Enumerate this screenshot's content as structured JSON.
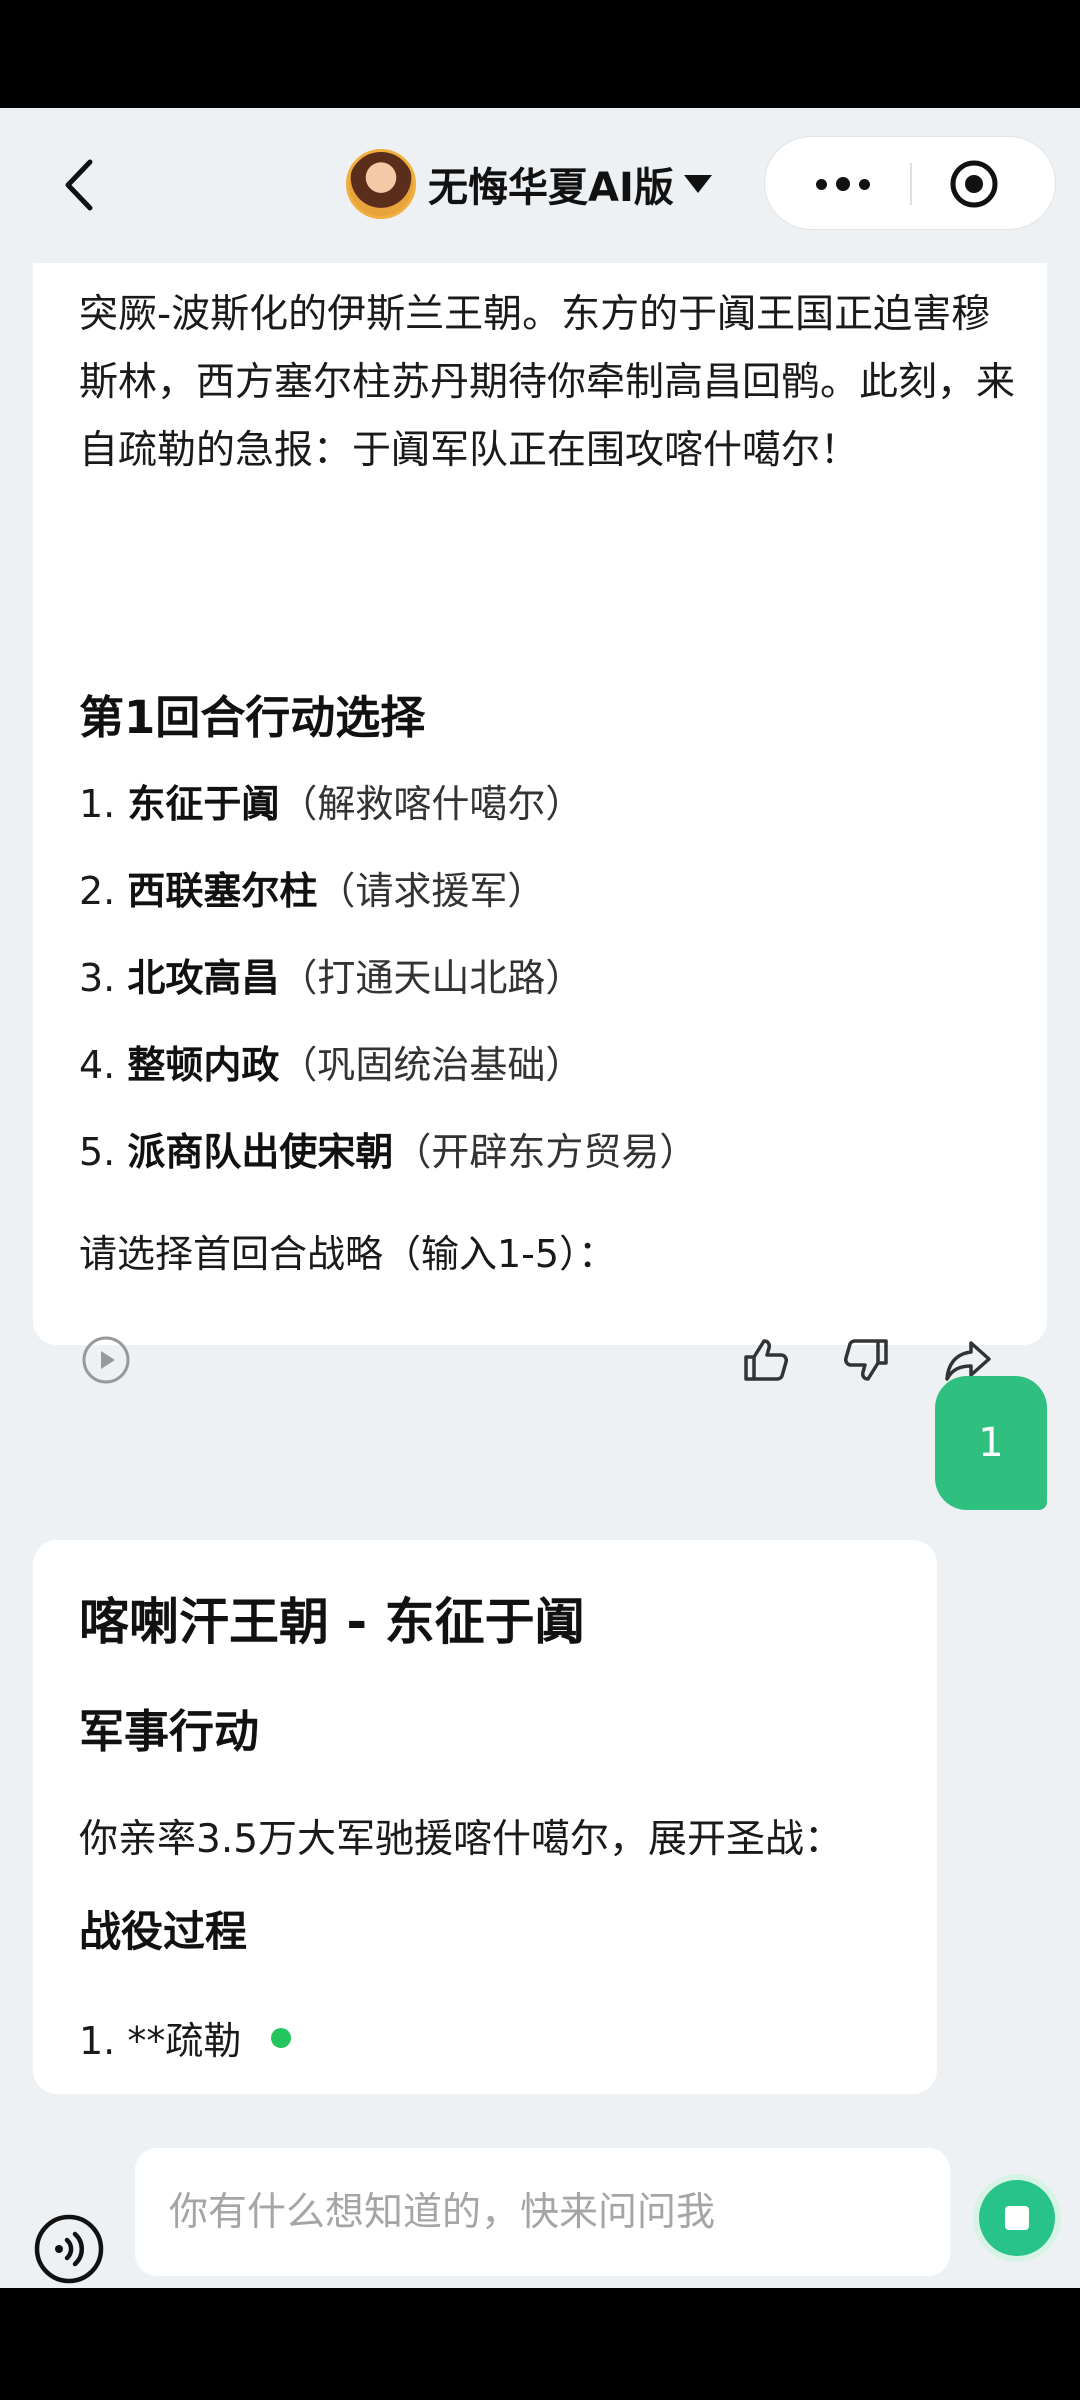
{
  "header": {
    "title": "无悔华夏AI版"
  },
  "message1": {
    "intro": "突厥-波斯化的伊斯兰王朝。东方的于阗王国正迫害穆斯林，西方塞尔柱苏丹期待你牵制高昌回鹘。此刻，来自疏勒的急报：于阗军队正在围攻喀什噶尔！",
    "heading": "第1回合行动选择",
    "options": [
      {
        "num": "1.",
        "label": "东征于阗",
        "note": "（解救喀什噶尔）"
      },
      {
        "num": "2.",
        "label": "西联塞尔柱",
        "note": "（请求援军）"
      },
      {
        "num": "3.",
        "label": "北攻高昌",
        "note": "（打通天山北路）"
      },
      {
        "num": "4.",
        "label": "整顿内政",
        "note": "（巩固统治基础）"
      },
      {
        "num": "5.",
        "label": "派商队出使宋朝",
        "note": "（开辟东方贸易）"
      }
    ],
    "prompt": "请选择首回合战略（输入1-5）："
  },
  "user_message": {
    "text": "1"
  },
  "message2": {
    "title": "喀喇汗王朝 - 东征于阗",
    "subtitle": "军事行动",
    "text": "你亲率3.5万大军驰援喀什噶尔，展开圣战：",
    "subtitle2": "战役过程",
    "item": "1. **疏勒"
  },
  "input": {
    "placeholder": "你有什么想知道的，快来问问我"
  },
  "colors": {
    "accent_green": "#2fc07f",
    "background": "#eef1f4",
    "typing_dot": "#22c55e"
  },
  "icons": [
    "back-arrow-icon",
    "avatar",
    "caret-down-icon",
    "more-icon",
    "record-icon",
    "play-icon",
    "thumbs-up-icon",
    "thumbs-down-icon",
    "share-icon",
    "voice-icon",
    "stop-icon"
  ]
}
